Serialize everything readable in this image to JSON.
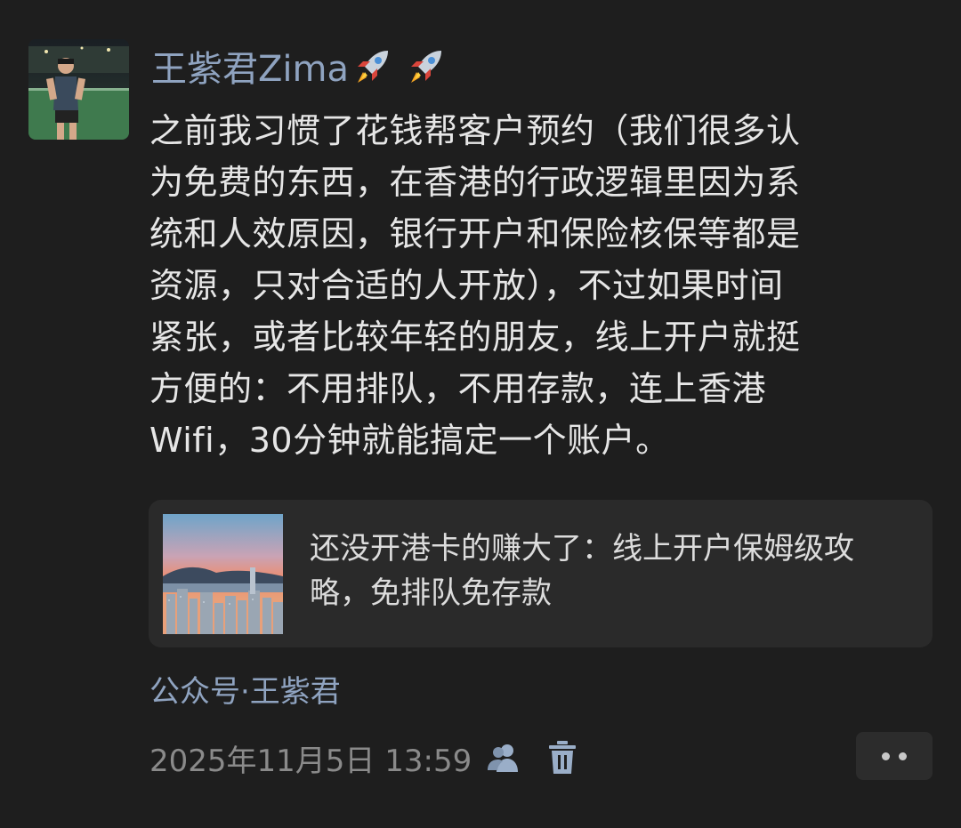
{
  "post": {
    "author": "王紫君Zima",
    "author_emoji": "rocket-icon",
    "body_lines": [
      "之前我习惯了花钱帮客户预约（我们很多认",
      "为免费的东西，在香港的行政逻辑里因为系",
      "统和人效原因，银行开户和保险核保等都是",
      "资源，只对合适的人开放），不过如果时间",
      "紧张，或者比较年轻的朋友，线上开户就挺",
      "方便的：不用排队，不用存款，连上香港",
      "Wifi，30分钟就能搞定一个账户。"
    ],
    "link_card": {
      "title_lines": [
        "还没开港卡的赚大了：线上开户保姆级攻",
        "略，免排队免存款"
      ],
      "thumbnail": "hong-kong-skyline-sunset"
    },
    "source": "公众号·王紫君",
    "timestamp": "2025年11月5日 13:59",
    "icons": {
      "visibility": "friends-icon",
      "delete": "trash-icon",
      "more": "more-dots-icon"
    }
  },
  "colors": {
    "background": "#1e1e1e",
    "name_blue": "#8fa3c0",
    "body_text": "#e6e6e6",
    "card_bg": "#2a2a2a",
    "meta_gray": "#8a8a8a"
  }
}
